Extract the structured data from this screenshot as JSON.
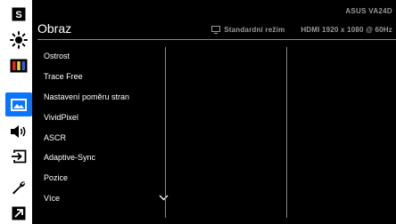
{
  "rail": {
    "items": [
      {
        "icon": "splendid-mode-icon",
        "glyph": "S",
        "active": false
      },
      {
        "icon": "brightness-sun-icon",
        "active": false
      },
      {
        "icon": "color-bars-icon",
        "active": false
      },
      {
        "icon": "image-icon",
        "active": true
      },
      {
        "icon": "speaker-volume-icon",
        "active": false
      },
      {
        "icon": "input-select-icon",
        "active": false
      },
      {
        "icon": "system-setup-wrench-icon",
        "active": false
      },
      {
        "icon": "shortcut-arrow-icon",
        "active": false
      }
    ],
    "accent": "#0b74ff"
  },
  "header": {
    "title": "Obraz",
    "model": "ASUS VA24D",
    "mode": "Standardní režim",
    "resolution": "HDMI 1920 x 1080 @ 60Hz"
  },
  "menu": {
    "items": [
      {
        "label": "Ostrost"
      },
      {
        "label": "Trace Free"
      },
      {
        "label": "Nastavení poměru stran"
      },
      {
        "label": "VividPixel"
      },
      {
        "label": "ASCR"
      },
      {
        "label": "Adaptive-Sync"
      },
      {
        "label": "Pozice"
      },
      {
        "label": "Více"
      }
    ]
  }
}
